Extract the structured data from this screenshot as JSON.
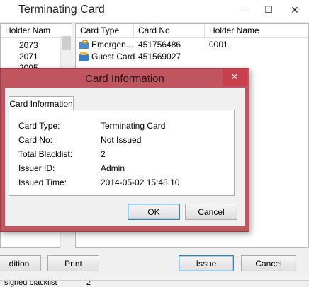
{
  "window": {
    "title": "Terminating Card",
    "minimize": "—",
    "maximize": "☐",
    "close": "✕"
  },
  "left_table": {
    "header": "Holder Nam",
    "rows": [
      "2073",
      "2071",
      "2095"
    ],
    "scroll_right": "›"
  },
  "right_table": {
    "headers": [
      "Card Type",
      "Card No",
      "Holder Name"
    ],
    "rows": [
      {
        "type": "Emergen...",
        "card_no": "451756486",
        "holder": "0001",
        "icon": "emergency-card-icon"
      },
      {
        "type": "Guest Card",
        "card_no": "451569027",
        "holder": "",
        "icon": "guest-card-icon"
      }
    ]
  },
  "bottom_buttons": {
    "edition": "dition",
    "print": "Print",
    "issue": "Issue",
    "cancel": "Cancel"
  },
  "status": {
    "label": "signed blacklist",
    "value": "2"
  },
  "dialog": {
    "title": "Card Information",
    "close": "✕",
    "tab": "Card Information",
    "fields": [
      {
        "label": "Card Type:",
        "value": "Terminating Card"
      },
      {
        "label": "Card No:",
        "value": "Not Issued"
      },
      {
        "label": "Total Blacklist:",
        "value": "2"
      },
      {
        "label": "Issuer ID:",
        "value": "Admin"
      },
      {
        "label": "Issued Time:",
        "value": "2014-05-02 15:48:10"
      }
    ],
    "ok": "OK",
    "cancel": "Cancel"
  },
  "colors": {
    "dialog_frame": "#c0555f",
    "close_red": "#c8404c",
    "window_bg": "#f0f0f0"
  }
}
